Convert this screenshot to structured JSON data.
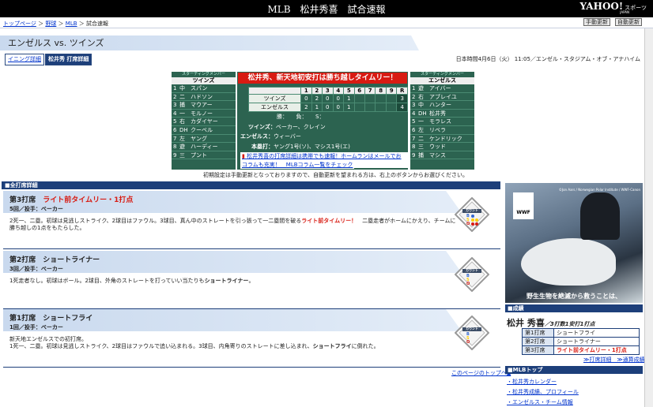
{
  "header": {
    "title": "MLB　松井秀喜　試合速報",
    "logo": "YAHOO!",
    "logo_sub": "JAPAN",
    "logo_label": "スポーツ"
  },
  "breadcrumbs": [
    "トップページ",
    "野球",
    "MLB",
    "試合速報"
  ],
  "buttons": {
    "manual": "手動更新",
    "auto": "自動更新"
  },
  "page_title": "エンゼルス vs. ツインズ",
  "tabs": {
    "inning": "イニング詳細",
    "detail": "松井秀 打席詳細"
  },
  "datetime": "日本時間4月6日（火） 11:05／エンゼル・スタジアム・オブ・アナハイム",
  "visitor": {
    "caption": "スターティングメンバー",
    "team": "ツインズ",
    "lineup": [
      {
        "no": "1",
        "pos": "中",
        "name": "スパン"
      },
      {
        "no": "2",
        "pos": "二",
        "name": "ハドソン"
      },
      {
        "no": "3",
        "pos": "捕",
        "name": "マウアー"
      },
      {
        "no": "4",
        "pos": "一",
        "name": "モルノー"
      },
      {
        "no": "5",
        "pos": "右",
        "name": "カダイヤー"
      },
      {
        "no": "6",
        "pos": "DH",
        "name": "クーベル"
      },
      {
        "no": "7",
        "pos": "左",
        "name": "ヤング"
      },
      {
        "no": "8",
        "pos": "遊",
        "name": "ハーディー"
      },
      {
        "no": "9",
        "pos": "三",
        "name": "プント"
      }
    ]
  },
  "home": {
    "caption": "スターティングメンバー",
    "team": "エンゼルス",
    "lineup": [
      {
        "no": "1",
        "pos": "遊",
        "name": "アイバー"
      },
      {
        "no": "2",
        "pos": "右",
        "name": "アブレイユ"
      },
      {
        "no": "3",
        "pos": "中",
        "name": "ハンター"
      },
      {
        "no": "4",
        "pos": "DH",
        "name": "松井秀"
      },
      {
        "no": "5",
        "pos": "一",
        "name": "モラレス"
      },
      {
        "no": "6",
        "pos": "左",
        "name": "リベラ"
      },
      {
        "no": "7",
        "pos": "二",
        "name": "ケンドリック"
      },
      {
        "no": "8",
        "pos": "三",
        "name": "ウッド"
      },
      {
        "no": "9",
        "pos": "捕",
        "name": "マシス"
      }
    ]
  },
  "headline": "松井秀、新天地初安打は勝ち越しタイムリー！",
  "scoreboard": {
    "innings": [
      "1",
      "2",
      "3",
      "4",
      "5",
      "6",
      "7",
      "8",
      "9",
      "R"
    ],
    "rows": [
      {
        "team": "ツインズ",
        "scores": [
          "0",
          "2",
          "0",
          "0",
          "1",
          "",
          "",
          "",
          "",
          "3"
        ]
      },
      {
        "team": "エンゼルス",
        "scores": [
          "2",
          "1",
          "0",
          "0",
          "1",
          "",
          "",
          "",
          "",
          "4"
        ]
      }
    ]
  },
  "pitchers": {
    "label": "勝：　　負：　　S：",
    "visitor_label": "ツインズ：",
    "visitor": "ベーカー、クレイン",
    "home_label": "エンゼルス：",
    "home": "ウィーバー",
    "hr_label": "本塁打：",
    "hr": "ヤング1号(ソ)、マシス1号(エ)"
  },
  "notes": [
    "松井秀喜の打席詳細は携帯でも速報！ホームランはメールでお知らせ",
    "コラムも充実！　MLBコラム一覧をチェック"
  ],
  "notice": "初期設定は手動更新となっておりますので、自動更新を望まれる方は、右上のボタンからお選びください。",
  "section_title": "全打席詳細",
  "at_bats": [
    {
      "title": "第3打席",
      "result": "ライト前タイムリー・1打点",
      "sub": "5回／投手：ベーカー",
      "desc_a": "2死一、二塁。初球は見逃しストライク、2球目はファウル。3球目、真ん中のストレートを引っ張って一二塁間を破る",
      "desc_red": "ライト前タイムリー！",
      "desc_b": "　二塁走者がホームにかえり、チームに勝ち越しの1点をもたらした。"
    },
    {
      "title": "第2打席",
      "result": "ショートライナー",
      "sub": "3回／投手：ベーカー",
      "desc_a": "1死走者なし。初球はボール。2球目、外角のストレートを打っていい当たりも",
      "desc_bold": "ショートライナー",
      "desc_b": "。"
    },
    {
      "title": "第1打席",
      "result": "ショートフライ",
      "sub": "1回／投手：ベーカー",
      "desc_a": "新天地エンゼルスでの初打席。\n1死一、二塁。初球は見逃しストライク、2球目はファウルで追い込まれる。3球目、内角寄りのストレートに差し込まれ、",
      "desc_bold": "ショートフライ",
      "desc_b": "に倒れた。"
    }
  ],
  "count_label": "カウント",
  "count_letters": [
    "B",
    "S",
    "O"
  ],
  "top_link": "このページのトップへ▲",
  "pr": {
    "label": "PR",
    "credit": "©Jon Aars / Norwegian Polar Institute / WWF-Canon",
    "org": "WWF",
    "slogan": "野生生物を絶滅から救うことは、"
  },
  "record": {
    "heading": "成績",
    "name": "松井 秀喜",
    "summary": "／3打数1安打1打点",
    "rows": [
      {
        "label": "第1打席",
        "value": "ショートフライ",
        "red": false
      },
      {
        "label": "第2打席",
        "value": "ショートライナー",
        "red": false
      },
      {
        "label": "第3打席",
        "value": "ライト前タイムリー・1打点",
        "red": true
      }
    ],
    "links": "≫打席詳細　≫通算成績"
  },
  "mlb": {
    "heading": "MLBトップ",
    "links": [
      "・松井秀カレンダー",
      "・松井秀成績、プロフィール",
      "・エンゼルス・チーム情報"
    ]
  }
}
